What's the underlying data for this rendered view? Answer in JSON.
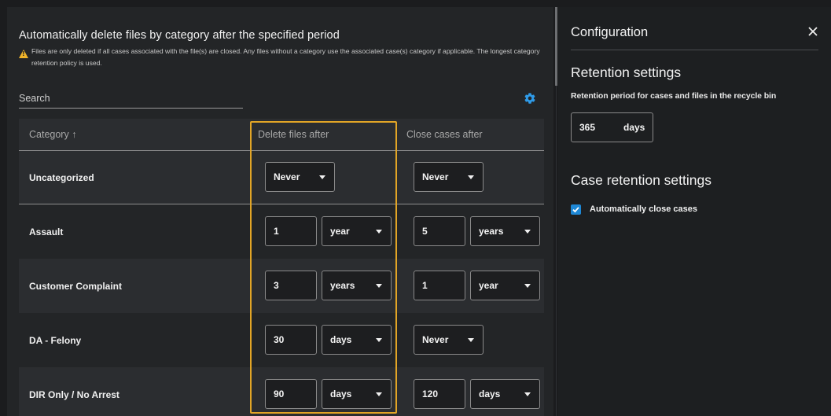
{
  "main": {
    "title": "Automatically delete files by category after the specified period",
    "warning": "Files are only deleted if all cases associated with the file(s) are closed. Any files without a category use the associated case(s) category if applicable. The longest category retention policy is used.",
    "search_label": "Search",
    "columns": [
      "Category ↑",
      "Delete files after",
      "Close cases after"
    ],
    "rows": [
      {
        "category": "Uncategorized",
        "delete": {
          "mode": "select",
          "value": "Never"
        },
        "close": {
          "mode": "select",
          "value": "Never"
        }
      },
      {
        "category": "Assault",
        "delete": {
          "mode": "num",
          "value": "1",
          "unit": "year"
        },
        "close": {
          "mode": "num",
          "value": "5",
          "unit": "years"
        }
      },
      {
        "category": "Customer Complaint",
        "delete": {
          "mode": "num",
          "value": "3",
          "unit": "years"
        },
        "close": {
          "mode": "num",
          "value": "1",
          "unit": "year"
        }
      },
      {
        "category": "DA - Felony",
        "delete": {
          "mode": "num",
          "value": "30",
          "unit": "days"
        },
        "close": {
          "mode": "select",
          "value": "Never"
        }
      },
      {
        "category": "DIR Only / No Arrest",
        "delete": {
          "mode": "num",
          "value": "90",
          "unit": "days"
        },
        "close": {
          "mode": "num",
          "value": "120",
          "unit": "days"
        }
      }
    ]
  },
  "config": {
    "title": "Configuration",
    "retention_title": "Retention settings",
    "retention_sub": "Retention period for cases and files in the recycle bin",
    "retention_value": "365",
    "retention_unit": "days",
    "case_title": "Case retention settings",
    "auto_close_label": "Automatically close cases",
    "auto_close_checked": true
  },
  "colors": {
    "accent": "#1e88d6",
    "highlight": "#e2a526",
    "warning": "#f0b429"
  },
  "icons": {
    "gear": "gear-icon",
    "close": "close-icon",
    "warning": "warning-icon",
    "sort": "arrow-up-icon"
  }
}
